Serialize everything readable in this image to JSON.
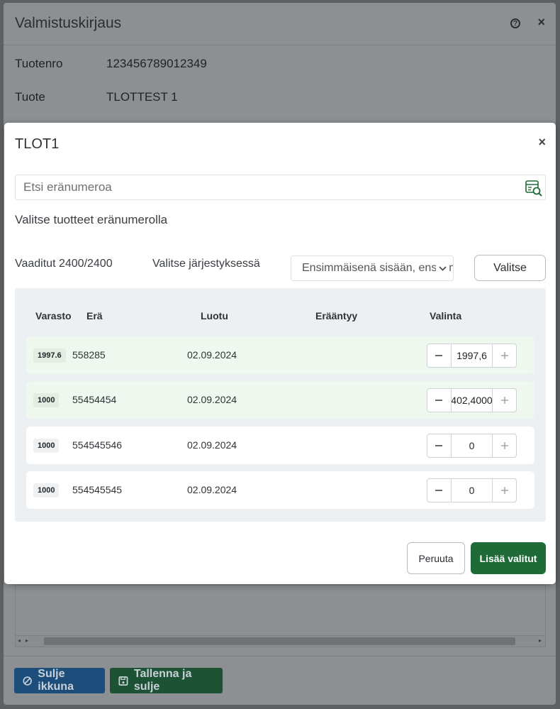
{
  "background": {
    "title": "Valmistuskirjaus",
    "product_number_label": "Tuotenro",
    "product_number_value": "123456789012349",
    "product_label": "Tuote",
    "product_value": "TLOTTEST 1",
    "close_window_label": "Sulje ikkuna",
    "save_close_label": "Tallenna ja sulje"
  },
  "modal": {
    "title": "TLOT1",
    "search_placeholder": "Etsi eränumeroa",
    "hint": "Valitse tuotteet eränumerolla",
    "required_text": "Vaaditut 2400/2400",
    "order_label": "Valitse järjestyksessä",
    "order_selected": "Ensimmäisenä sisään, ensimmäisenä ulos",
    "select_button": "Valitse",
    "table": {
      "headers": {
        "warehouse": "Varasto",
        "lot": "Erä",
        "created": "Luotu",
        "expires": "Erääntyy",
        "selection": "Valinta"
      },
      "rows": [
        {
          "warehouse": "1997.6",
          "lot": "558285",
          "created": "02.09.2024",
          "expires": "",
          "selection": "1997,6"
        },
        {
          "warehouse": "1000",
          "lot": "55454454",
          "created": "02.09.2024",
          "expires": "",
          "selection": "402,4000"
        },
        {
          "warehouse": "1000",
          "lot": "554545546",
          "created": "02.09.2024",
          "expires": "",
          "selection": "0"
        },
        {
          "warehouse": "1000",
          "lot": "554545545",
          "created": "02.09.2024",
          "expires": "",
          "selection": "0"
        }
      ]
    },
    "cancel_button": "Peruuta",
    "add_button": "Lisää valitut"
  },
  "colors": {
    "primary_green": "#1f6b38",
    "row_selected": "#eef8ee",
    "overlay": "#5e6163"
  }
}
